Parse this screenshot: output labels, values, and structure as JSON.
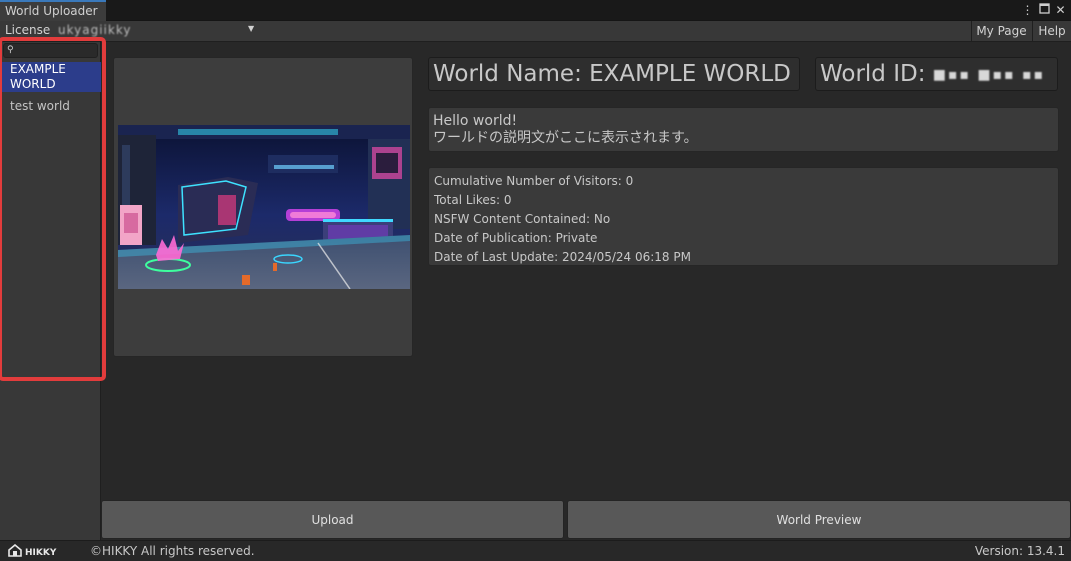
{
  "window": {
    "tab_title": "World Uploader"
  },
  "toolbar": {
    "license_label": "License",
    "license_value": "ukyagiikky",
    "my_page_label": "My Page",
    "help_label": "Help"
  },
  "sidebar": {
    "search": {
      "value": "",
      "placeholder": ""
    },
    "worlds": [
      {
        "name": "EXAMPLE WORLD",
        "selected": true
      },
      {
        "name": "test world",
        "selected": false
      }
    ]
  },
  "details": {
    "world_name": "World Name: EXAMPLE WORLD",
    "world_id_label": "World ID:",
    "world_id_value": "■▪▪ ■▪▪ ▪▪",
    "description_line1": "Hello world!",
    "description_line2": "ワールドの説明文がここに表示されます。",
    "stats": [
      "Cumulative Number of Visitors: 0",
      "Total Likes: 0",
      "NSFW Content Contained: No",
      "Date of Publication: Private",
      "Date of Last Update: 2024/05/24 06:18 PM"
    ]
  },
  "actions": {
    "upload_label": "Upload",
    "preview_label": "World Preview"
  },
  "footer": {
    "logo_text": "HIKKY",
    "copyright": "©HIKKY All rights reserved.",
    "version": "Version: 13.4.1"
  },
  "colors": {
    "selection": "#2c3d8b",
    "highlight": "#e23c3c",
    "tab_accent": "#3a79bb"
  }
}
